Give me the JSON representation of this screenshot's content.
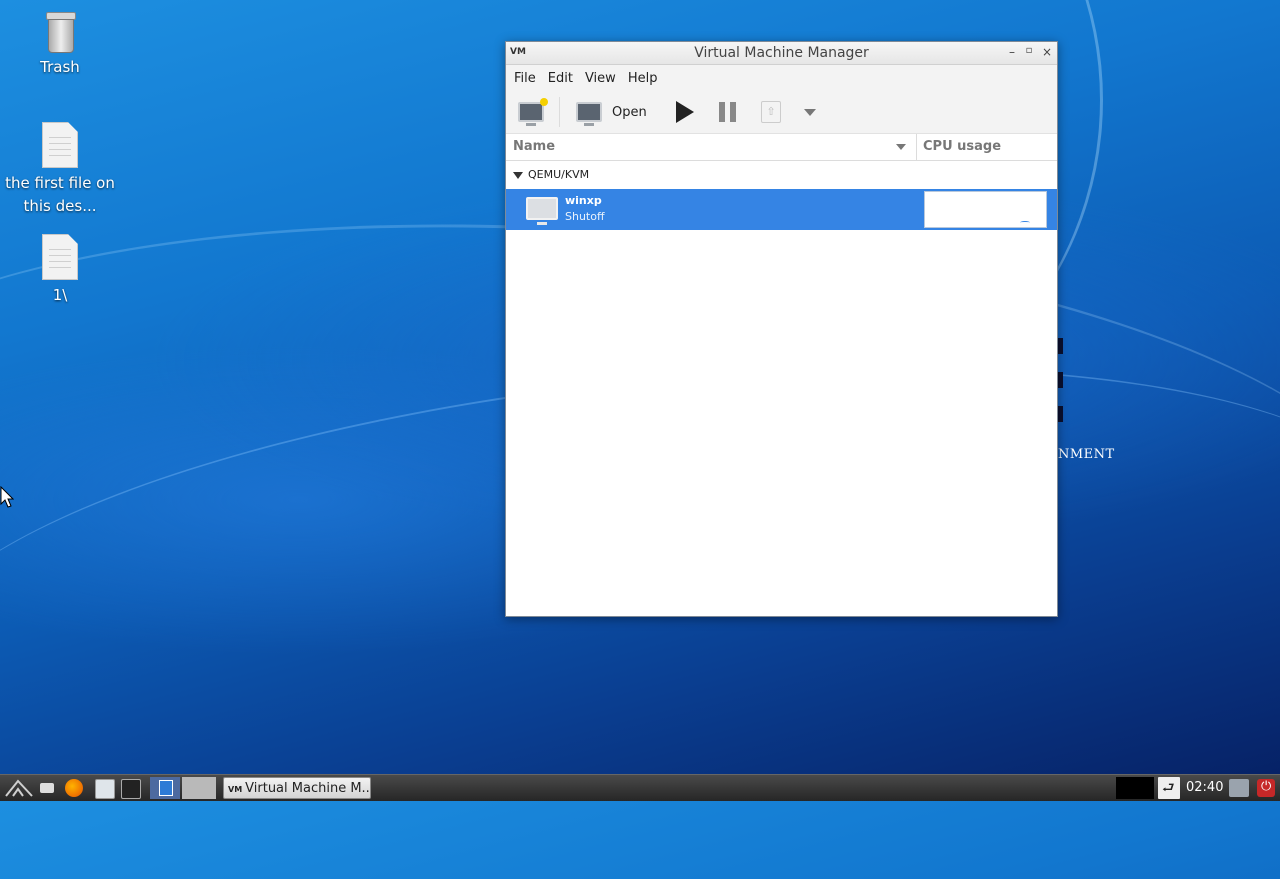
{
  "desktop": {
    "icons": [
      {
        "label": "Trash"
      },
      {
        "label": "the first file on this des..."
      },
      {
        "label": "1\\"
      }
    ],
    "watermark": "NMENT"
  },
  "window": {
    "title": "Virtual Machine Manager",
    "app_icon": "VM",
    "menu": [
      "File",
      "Edit",
      "View",
      "Help"
    ],
    "toolbar": {
      "open_label": "Open"
    },
    "columns": {
      "name": "Name",
      "cpu": "CPU usage"
    },
    "group": "QEMU/KVM",
    "vms": [
      {
        "name": "winxp",
        "state": "Shutoff"
      }
    ]
  },
  "taskbar": {
    "task_label": "Virtual Machine M...",
    "task_icon": "VM",
    "clock": "02:40"
  },
  "colors": {
    "selection": "#3584e4",
    "desktop_blue": "#1277cf"
  }
}
